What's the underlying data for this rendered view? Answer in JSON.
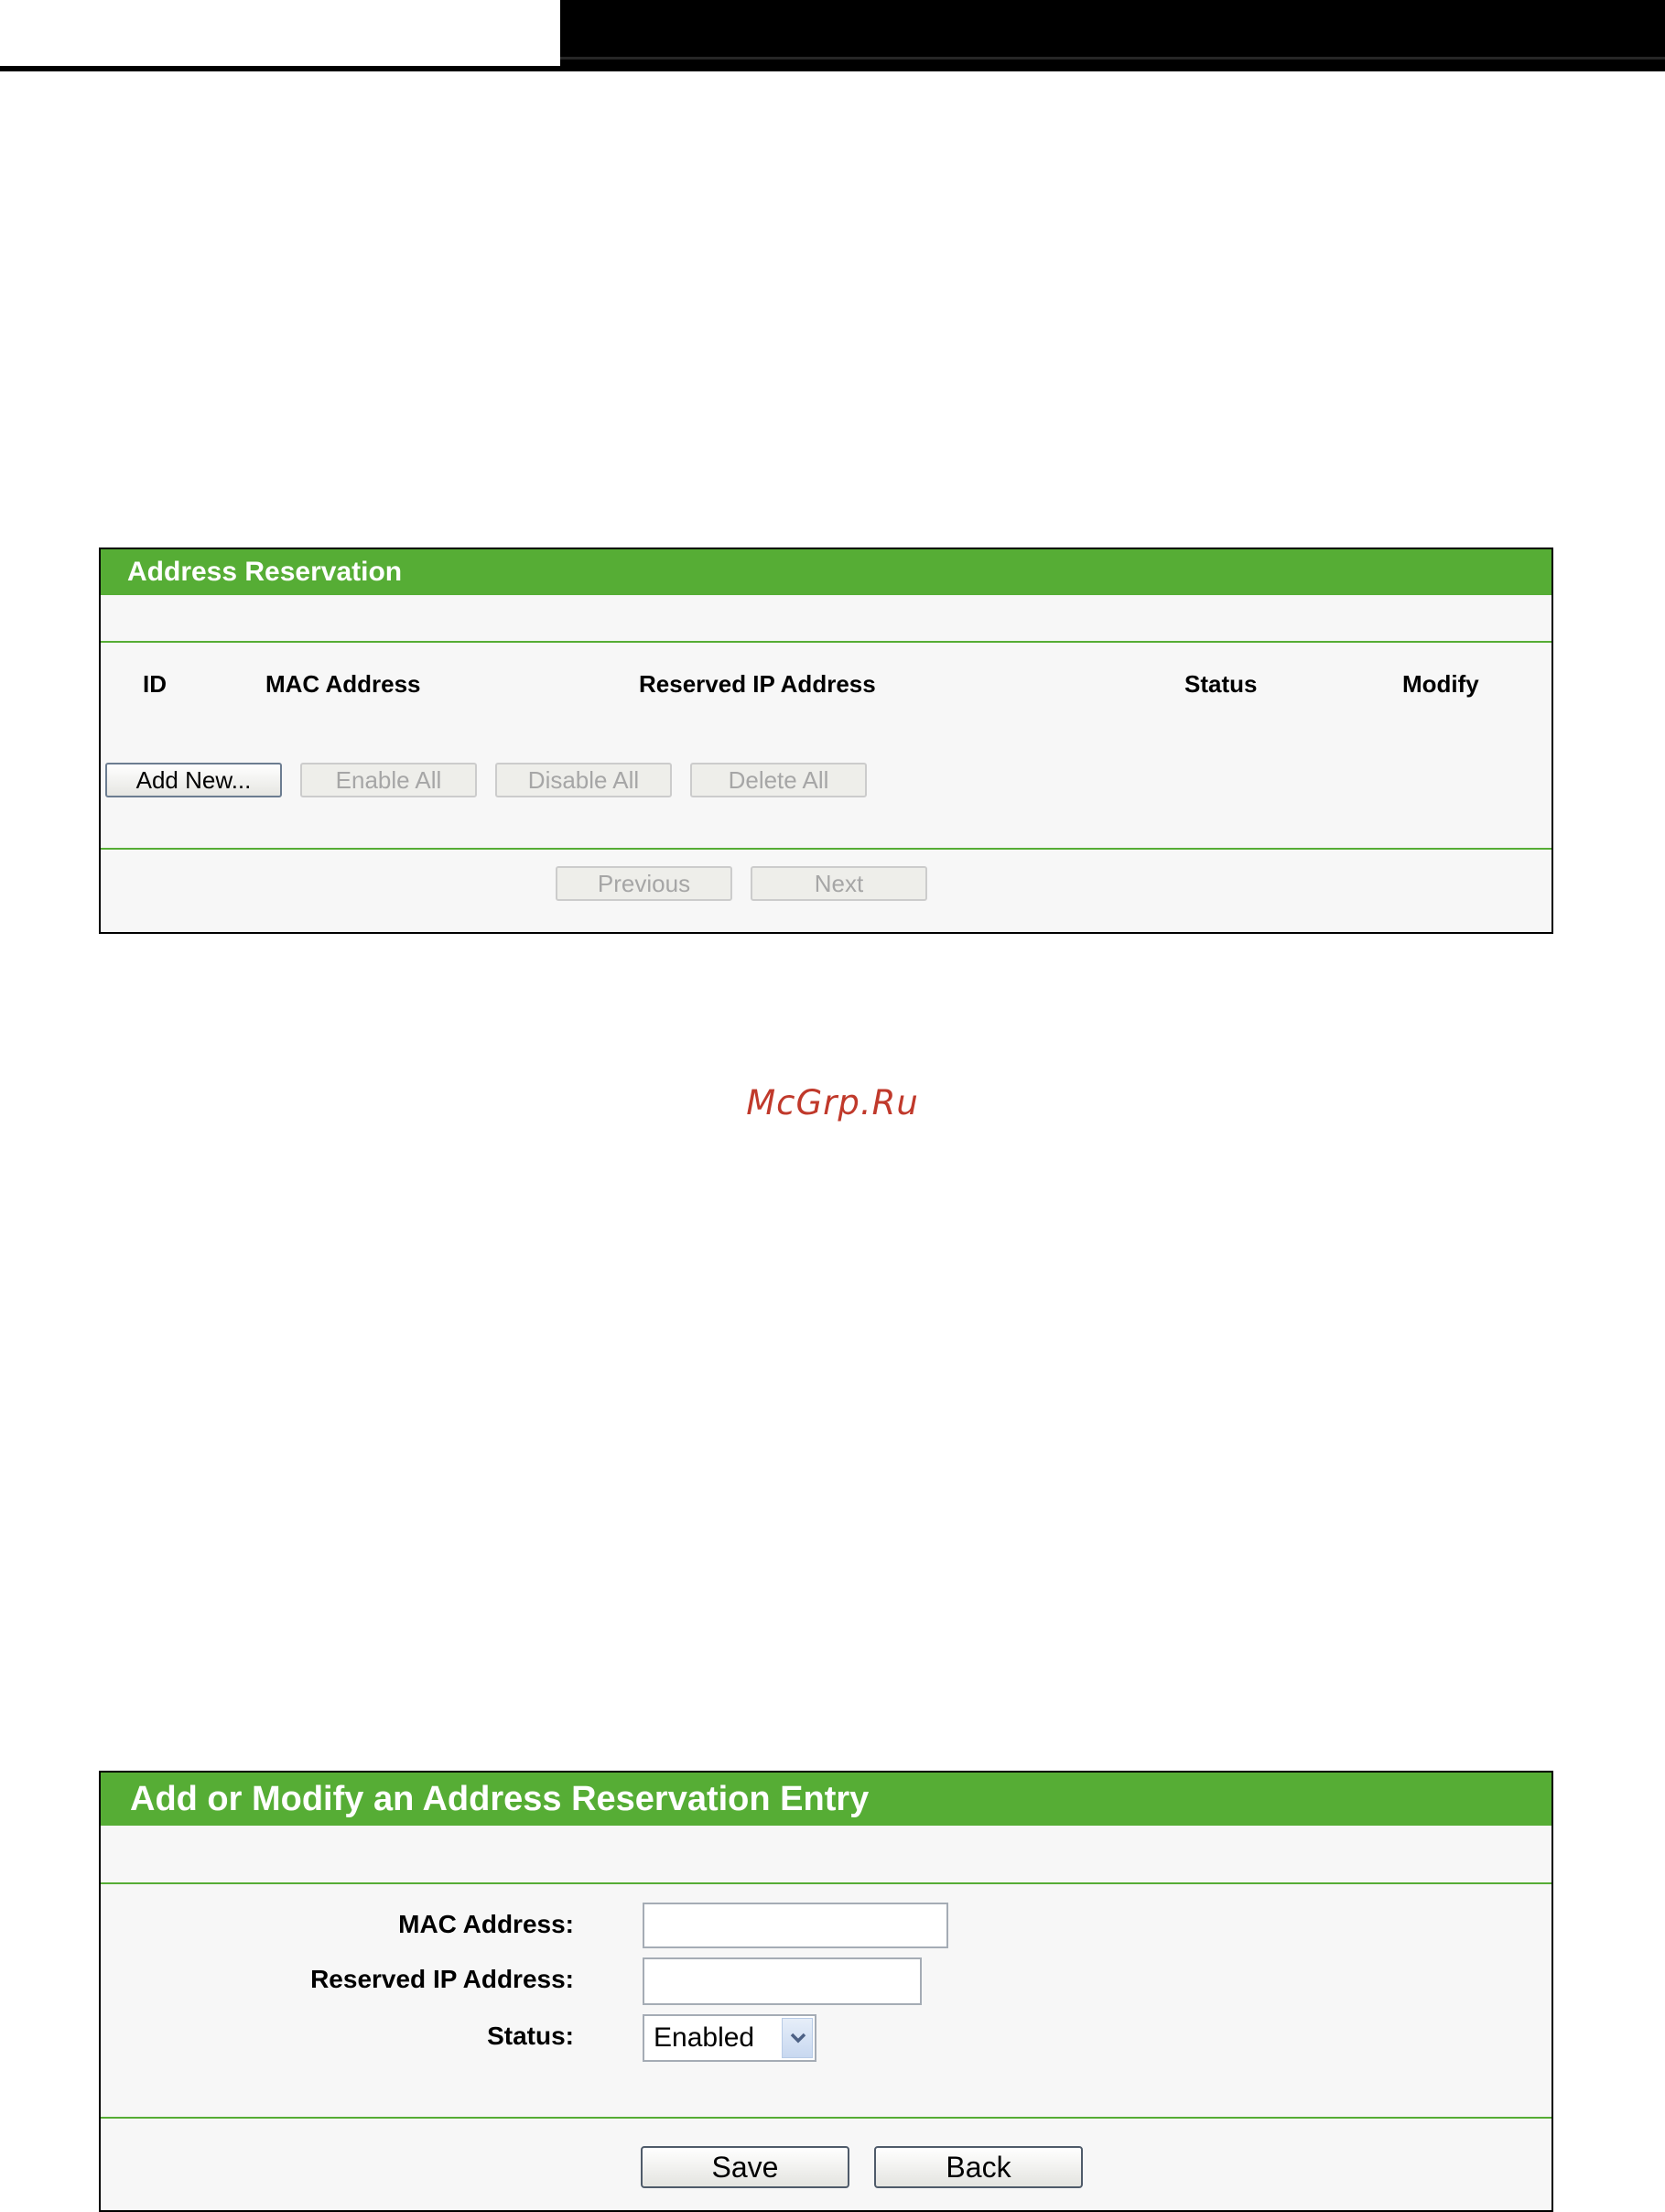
{
  "reservation_panel": {
    "title": "Address Reservation",
    "columns": {
      "id": "ID",
      "mac": "MAC Address",
      "ip": "Reserved IP Address",
      "status": "Status",
      "modify": "Modify"
    },
    "buttons": {
      "add_new": "Add New...",
      "enable_all": "Enable All",
      "disable_all": "Disable All",
      "delete_all": "Delete All",
      "previous": "Previous",
      "next": "Next"
    }
  },
  "watermark": "McGrp.Ru",
  "entry_panel": {
    "title": "Add or Modify an Address Reservation Entry",
    "mac_label": "MAC Address:",
    "mac_value": "",
    "ip_label": "Reserved IP Address:",
    "ip_value": "",
    "status_label": "Status:",
    "status_value": "Enabled",
    "buttons": {
      "save": "Save",
      "back": "Back"
    }
  },
  "colors": {
    "accent_green": "#56ad35",
    "watermark_red": "#c0392b"
  }
}
